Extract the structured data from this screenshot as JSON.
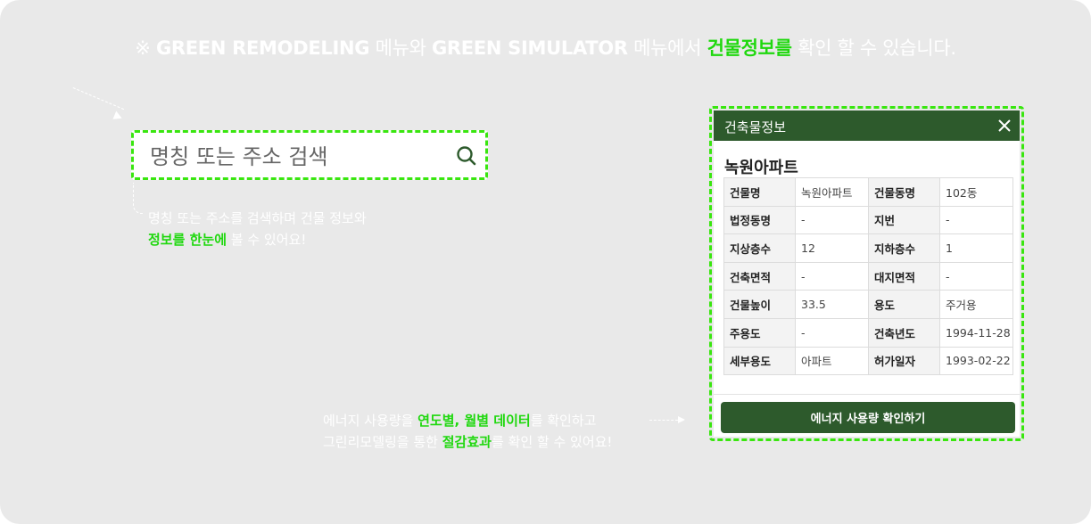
{
  "notice": {
    "mark": "※",
    "part1": "GREEN REMODELING",
    "part2": " 메뉴와 ",
    "part3": "GREEN SIMULATOR",
    "part4": " 메뉴에서 ",
    "highlight": "건물정보를",
    "part5": " 확인 할 수 있습니다."
  },
  "search": {
    "placeholder": "명칭 또는 주소 검색",
    "icon": "search-icon"
  },
  "search_hint": {
    "line1": "명칭 또는 주소를 검색하며 건물 정보와",
    "line2_highlight": "정보를 한눈에",
    "line2_rest": " 볼 수 있어요!"
  },
  "panel": {
    "title": "건축물정보",
    "close_icon": "close-icon",
    "building_name": "녹원아파트",
    "rows": [
      {
        "l1": "건물명",
        "v1": "녹원아파트",
        "l2": "건물동명",
        "v2": "102동"
      },
      {
        "l1": "법정동명",
        "v1": "-",
        "l2": "지번",
        "v2": "-"
      },
      {
        "l1": "지상층수",
        "v1": "12",
        "l2": "지하층수",
        "v2": "1"
      },
      {
        "l1": "건축면적",
        "v1": "-",
        "l2": "대지면적",
        "v2": "-"
      },
      {
        "l1": "건물높이",
        "v1": "33.5",
        "l2": "용도",
        "v2": "주거용"
      },
      {
        "l1": "주용도",
        "v1": "-",
        "l2": "건축년도",
        "v2": "1994-11-28"
      },
      {
        "l1": "세부용도",
        "v1": "아파트",
        "l2": "허가일자",
        "v2": "1993-02-22"
      }
    ],
    "energy_button": "에너지 사용량 확인하기"
  },
  "energy_hint": {
    "line1_a": "에너지 사용량을 ",
    "line1_hl": "연도별, 월별 데이터",
    "line1_b": "를 확인하고",
    "line2_a": "그린리모델링을 통한 ",
    "line2_hl": "절감효과",
    "line2_b": "를 확인 할 수 있어요!"
  },
  "colors": {
    "accent_green": "#39e60f",
    "highlight_text": "#1fd80e",
    "header_green": "#2d5a2c",
    "background": "#e9e9e9"
  }
}
